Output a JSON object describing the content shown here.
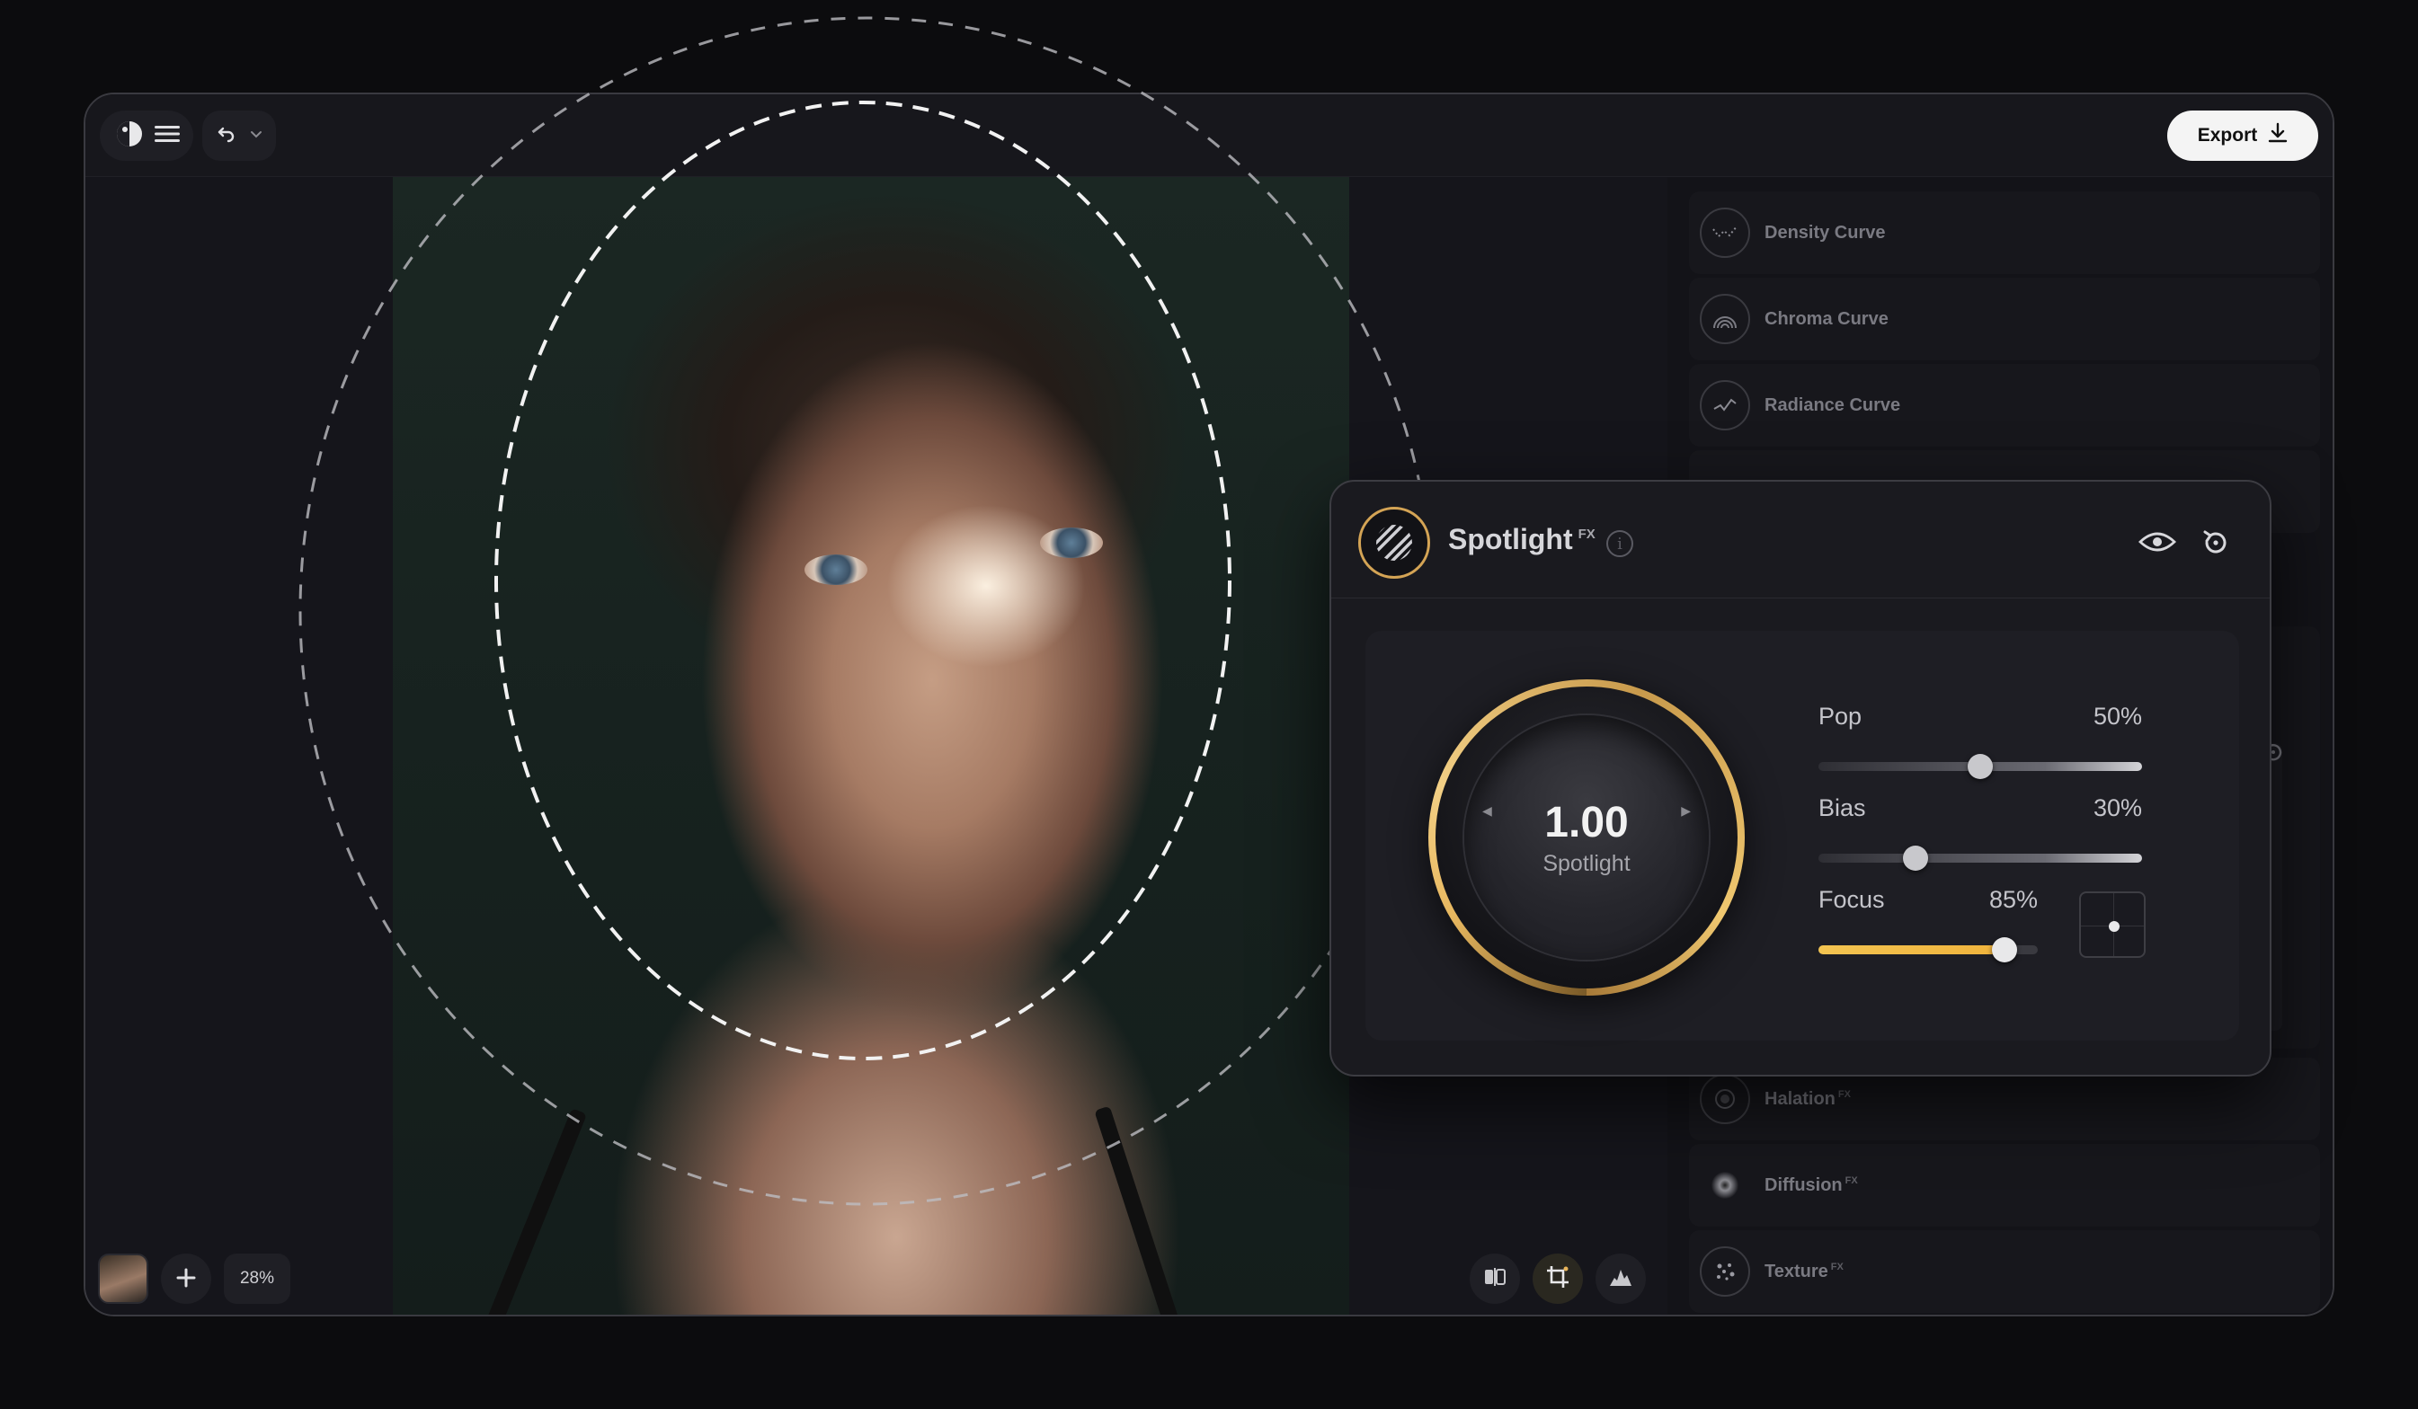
{
  "toolbar": {
    "export_label": "Export"
  },
  "canvas": {
    "zoom": "28%"
  },
  "right_panel": {
    "items": [
      {
        "label": "Density Curve",
        "fx": ""
      },
      {
        "label": "Chroma Curve",
        "fx": ""
      },
      {
        "label": "Radiance Curve",
        "fx": ""
      },
      {
        "label": "Halation",
        "fx": "FX"
      },
      {
        "label": "Diffusion",
        "fx": "FX"
      },
      {
        "label": "Texture",
        "fx": "FX"
      }
    ]
  },
  "spotlight_panel": {
    "title": "Spotlight",
    "title_sup": "FX",
    "knob_value": "1.00",
    "knob_label": "Spotlight",
    "sliders": [
      {
        "name": "Pop",
        "value_text": "50%",
        "value": 0.5
      },
      {
        "name": "Bias",
        "value_text": "30%",
        "value": 0.3
      },
      {
        "name": "Focus",
        "value_text": "85%",
        "value": 0.85
      }
    ]
  },
  "colors": {
    "accent_gold": "#e8b55a",
    "slider_active": "#f2bd48",
    "background": "#0c0c0e"
  },
  "icons": [
    "menu-icon",
    "undo-icon",
    "chevron-down-icon",
    "download-icon",
    "plus-icon",
    "compare-icon",
    "crop-icon",
    "histogram-icon",
    "eye-icon",
    "reset-icon",
    "info-icon"
  ]
}
